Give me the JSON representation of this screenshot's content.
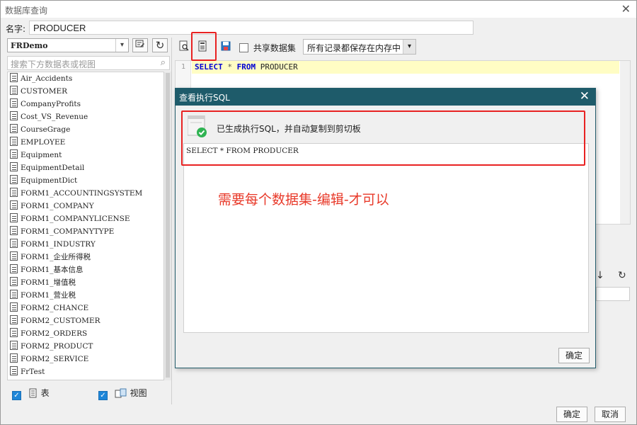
{
  "window": {
    "title": "数据库查询",
    "close_glyph": "✕",
    "name_label": "名字:",
    "name_value": "PRODUCER"
  },
  "left_panel": {
    "datasource": "FRDemo",
    "search_placeholder": "搜索下方数据表或视图",
    "tables": [
      "Air_Accidents",
      "CUSTOMER",
      "CompanyProfits",
      "Cost_VS_Revenue",
      "CourseGrage",
      "EMPLOYEE",
      "Equipment",
      "EquipmentDetail",
      "EquipmentDict",
      "FORM1_ACCOUNTINGSYSTEM",
      "FORM1_COMPANY",
      "FORM1_COMPANYLICENSE",
      "FORM1_COMPANYTYPE",
      "FORM1_INDUSTRY",
      "FORM1_企业所得税",
      "FORM1_基本信息",
      "FORM1_增值税",
      "FORM1_营业税",
      "FORM2_CHANCE",
      "FORM2_CUSTOMER",
      "FORM2_ORDERS",
      "FORM2_PRODUCT",
      "FORM2_SERVICE",
      "FrTest"
    ],
    "check_table_label": "表",
    "check_view_label": "视图"
  },
  "toolbar": {
    "share_label": "共享数据集",
    "memory_select": "所有记录都保存在内存中"
  },
  "editor": {
    "line_number": "1",
    "kw_select": "SELECT",
    "star": "*",
    "kw_from": "FROM",
    "table": "PRODUCER"
  },
  "dialog": {
    "title": "查看执行SQL",
    "message": "已生成执行SQL，并自动复制到剪切板",
    "sql": "SELECT * FROM PRODUCER",
    "annotation": "需要每个数据集-编辑-才可以",
    "ok_label": "确定"
  },
  "footer": {
    "ok_label": "确定",
    "cancel_label": "取消"
  },
  "colors": {
    "dialog_title_bg": "#1e5b6a",
    "highlight": "#e82222",
    "keyword": "#0000d4",
    "check_blue": "#1e86d8"
  },
  "icons": {
    "refresh": "↻",
    "down_arrow": "↓",
    "search": "⌕",
    "dropdown": "▾"
  }
}
